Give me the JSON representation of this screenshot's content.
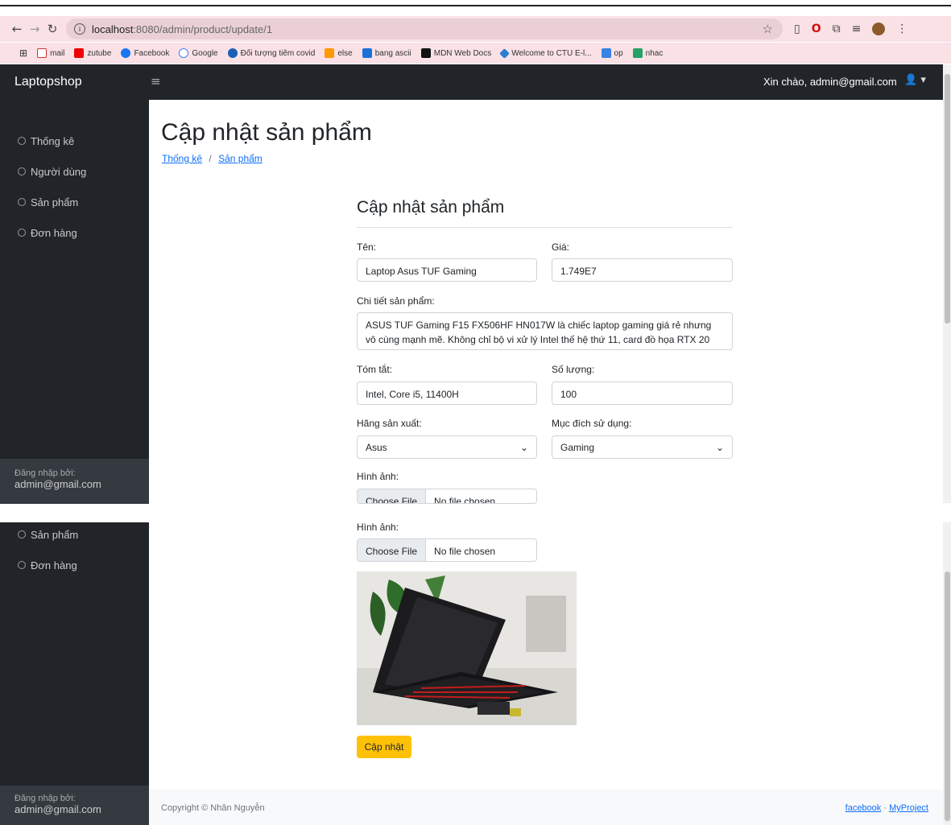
{
  "browser": {
    "url_host": "localhost",
    "url_path": ":8080/admin/product/update/1",
    "bookmarks": [
      "mail",
      "zutube",
      "Facebook",
      "Google",
      "Đối tượng tiêm covid",
      "else",
      "bang ascii",
      "MDN Web Docs",
      "Welcome to CTU E-l...",
      "op",
      "nhac"
    ]
  },
  "topbar": {
    "brand": "Laptopshop",
    "toggle_icon": "≡",
    "greeting": "Xin chào, admin@gmail.com"
  },
  "sidebar": {
    "items": [
      "Thống kê",
      "Người dùng",
      "Sản phẩm",
      "Đơn hàng"
    ],
    "footer_label": "Đăng nhập bởi:",
    "footer_user": "admin@gmail.com"
  },
  "page": {
    "title": "Cập nhật sản phẩm",
    "breadcrumb": [
      "Thống kê",
      "Sản phẩm"
    ],
    "breadcrumb_sep": "/"
  },
  "form": {
    "heading": "Cập nhật sản phẩm",
    "name_label": "Tên:",
    "name_value": "Laptop Asus TUF Gaming",
    "price_label": "Giá:",
    "price_value": "1.749E7",
    "detail_label": "Chi tiết sản phẩm:",
    "detail_value": "ASUS TUF Gaming F15 FX506HF HN017W là chiếc laptop gaming giá rẻ nhưng vô cùng mạnh mẽ. Không chỉ bộ vi xử lý Intel thế hệ thứ 11, card đồ họa RTX 20",
    "summary_label": "Tóm tắt:",
    "summary_value": "Intel, Core i5, 11400H",
    "qty_label": "Số lượng:",
    "qty_value": "100",
    "brand_label": "Hãng sản xuất:",
    "brand_value": "Asus",
    "purpose_label": "Mục đích sử dụng:",
    "purpose_value": "Gaming",
    "image_label": "Hình ảnh:",
    "file_button": "Choose File",
    "file_status": "No file chosen",
    "submit": "Cập nhật"
  },
  "footer": {
    "copyright": "Copyright © Nhân Nguyễn",
    "link1": "facebook",
    "sep": "·",
    "link2": "MyProject"
  },
  "colors": {
    "dark": "#212529",
    "warning": "#ffc107",
    "link": "#0d6efd",
    "chrome": "#f9e1e6"
  }
}
